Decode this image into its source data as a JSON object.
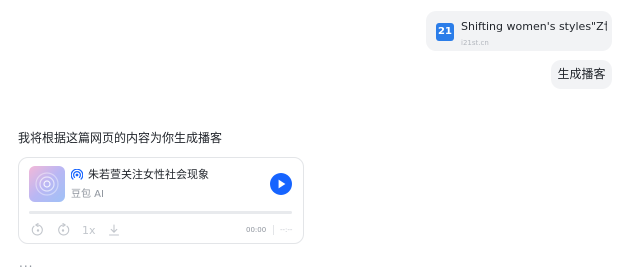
{
  "shared_link": {
    "logo_text": "21",
    "logo_icon": "site-logo-icon",
    "title": "Shifting women's styles\"Z世…",
    "domain": "i21st.cn"
  },
  "user_message": "生成播客",
  "assistant": {
    "intro": "我将根据这篇网页的内容为你生成播客",
    "loading": "..."
  },
  "podcast": {
    "title": "朱若萱关注女性社会现象",
    "author": "豆包 AI",
    "speed": "1x",
    "current_time": "00:00",
    "total_time": "--:--",
    "progress": 0,
    "accent_color": "#1664ff",
    "icons": {
      "title": "broadcast-icon",
      "play": "play-icon",
      "rewind": "rewind-15-icon",
      "forward": "forward-15-icon",
      "download": "download-icon"
    }
  }
}
